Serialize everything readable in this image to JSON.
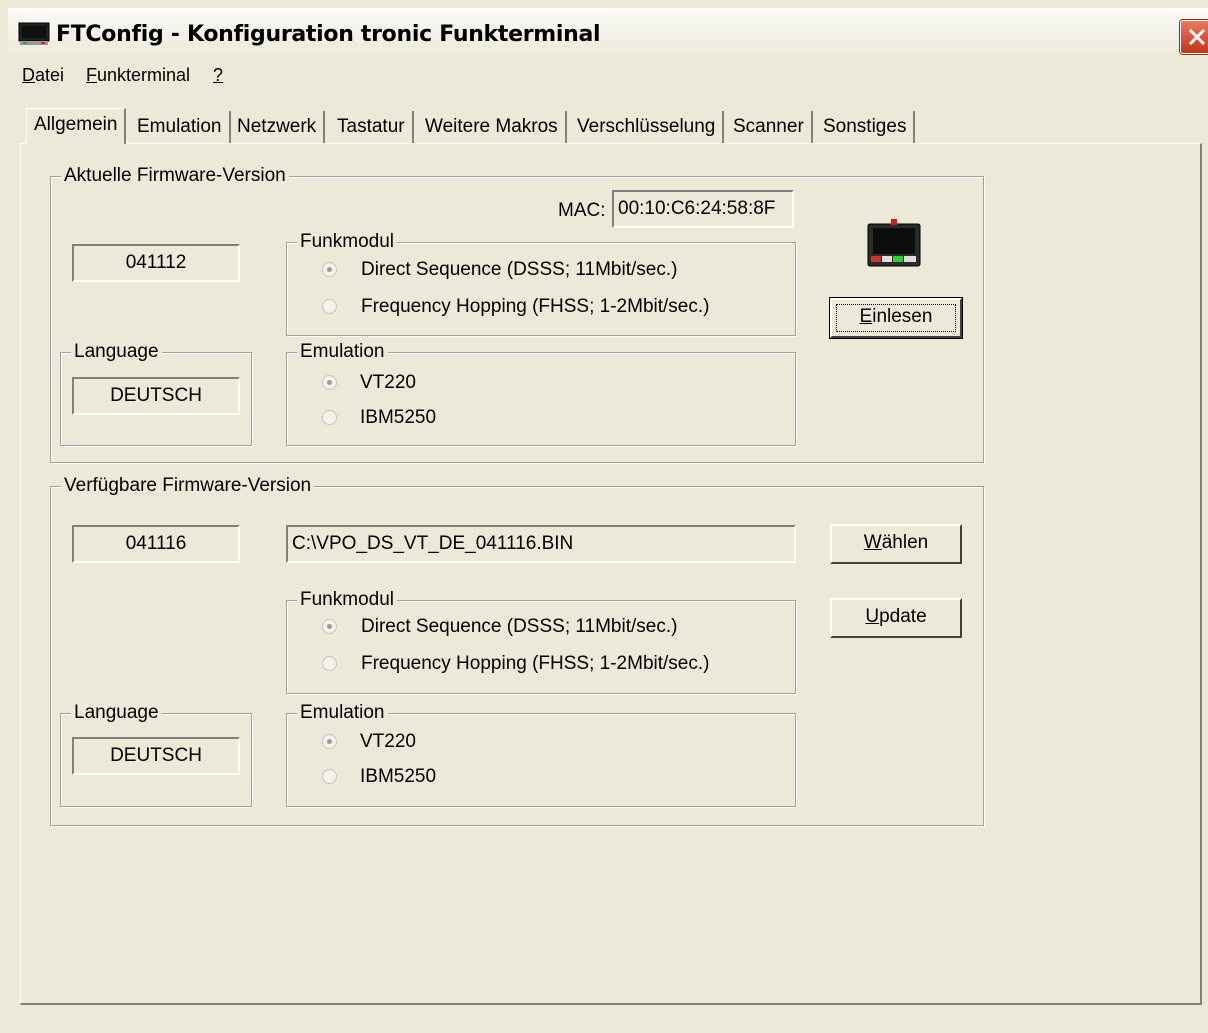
{
  "window": {
    "title": "FTConfig - Konfiguration tronic Funkterminal",
    "icon": "terminal-icon",
    "close_icon": "close-icon"
  },
  "menu": {
    "items": [
      {
        "label": "Datei",
        "mnemonic": "D"
      },
      {
        "label": "Funkterminal",
        "mnemonic": "F"
      },
      {
        "label": "?",
        "mnemonic": "?"
      }
    ]
  },
  "tabs": [
    {
      "label": "Allgemein",
      "active": true
    },
    {
      "label": "Emulation"
    },
    {
      "label": "Netzwerk"
    },
    {
      "label": "Tastatur"
    },
    {
      "label": "Weitere Makros"
    },
    {
      "label": "Verschlüsselung"
    },
    {
      "label": "Scanner"
    },
    {
      "label": "Sonstiges"
    }
  ],
  "current": {
    "group_label": "Aktuelle Firmware-Version",
    "version": "041112",
    "mac_label": "MAC:",
    "mac_value": "00:10:C6:24:58:8F",
    "language_label": "Language",
    "language_value": "DEUTSCH",
    "funkmodul_label": "Funkmodul",
    "funkmodul_options": [
      {
        "label": "Direct Sequence (DSSS; 11Mbit/sec.)",
        "checked": true
      },
      {
        "label": "Frequency Hopping (FHSS; 1-2Mbit/sec.)",
        "checked": false
      }
    ],
    "emulation_label": "Emulation",
    "emulation_options": [
      {
        "label": "VT220",
        "checked": true
      },
      {
        "label": "IBM5250",
        "checked": false
      }
    ],
    "read_button": {
      "pre": "",
      "mn": "E",
      "post": "inlesen"
    },
    "device_icon": "device-terminal-icon"
  },
  "available": {
    "group_label": "Verfügbare Firmware-Version",
    "version": "041116",
    "file_path": "C:\\VPO_DS_VT_DE_041116.BIN",
    "select_button": {
      "pre": "",
      "mn": "W",
      "post": "ählen"
    },
    "update_button": {
      "pre": "",
      "mn": "U",
      "post": "pdate"
    },
    "language_label": "Language",
    "language_value": "DEUTSCH",
    "funkmodul_label": "Funkmodul",
    "funkmodul_options": [
      {
        "label": "Direct Sequence (DSSS; 11Mbit/sec.)",
        "checked": true
      },
      {
        "label": "Frequency Hopping (FHSS; 1-2Mbit/sec.)",
        "checked": false
      }
    ],
    "emulation_label": "Emulation",
    "emulation_options": [
      {
        "label": "VT220",
        "checked": true
      },
      {
        "label": "IBM5250",
        "checked": false
      }
    ]
  },
  "colors": {
    "dialog_bg": "#ece9d8",
    "close_red": "#c2351a"
  }
}
